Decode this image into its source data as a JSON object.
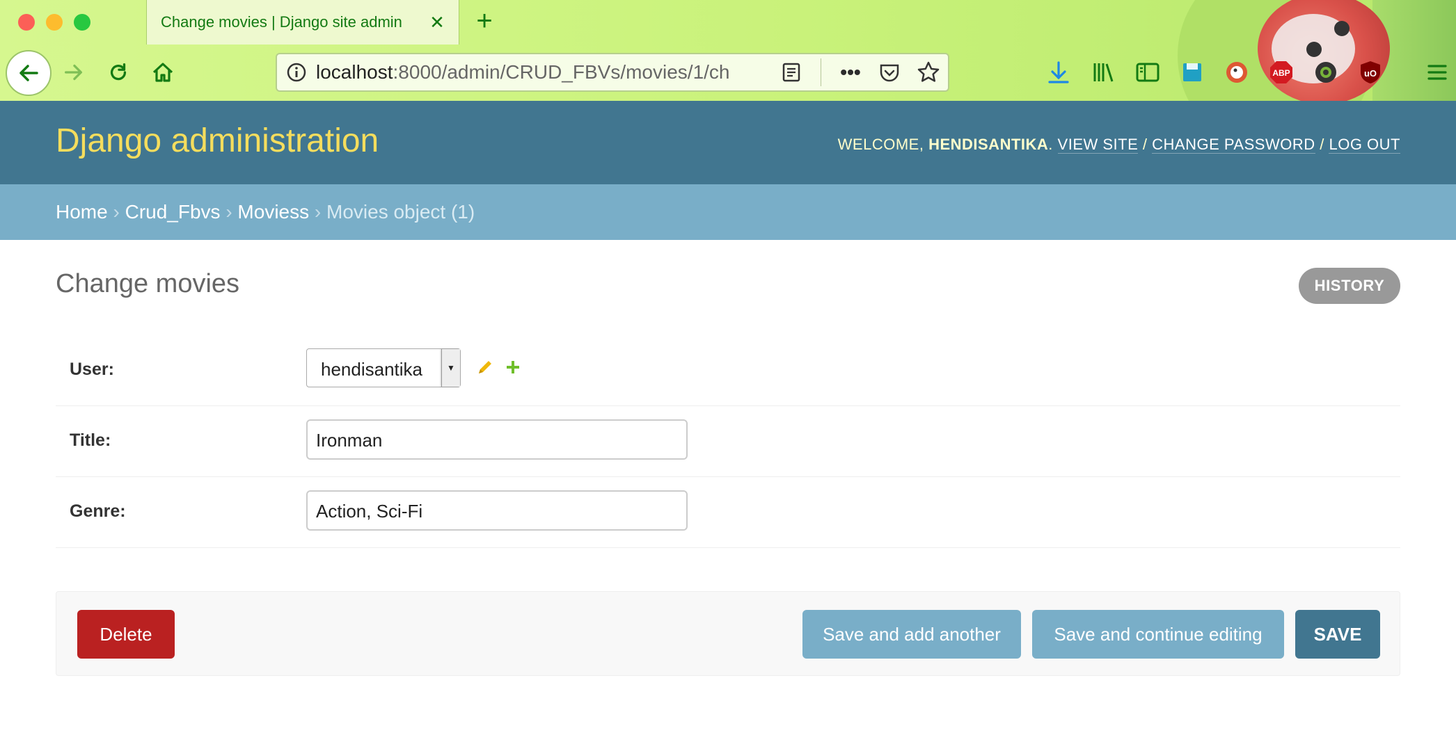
{
  "browser": {
    "tab_title": "Change movies | Django site admin",
    "url_host": "localhost",
    "url_rest": ":8000/admin/CRUD_FBVs/movies/1/ch",
    "colors": {
      "chrome": "#c9f27a",
      "icon": "#137a13"
    }
  },
  "header": {
    "branding": "Django administration",
    "welcome": "WELCOME,",
    "username": "HENDISANTIKA",
    "view_site": "VIEW SITE",
    "change_password": "CHANGE PASSWORD",
    "log_out": "LOG OUT",
    "separator": "/"
  },
  "breadcrumbs": {
    "items": [
      "Home",
      "Crud_Fbvs",
      "Moviess"
    ],
    "current": "Movies object (1)",
    "separator": "›"
  },
  "page": {
    "title": "Change movies",
    "history": "HISTORY"
  },
  "form": {
    "user": {
      "label": "User:",
      "value": "hendisantika"
    },
    "title": {
      "label": "Title:",
      "value": "Ironman"
    },
    "genre": {
      "label": "Genre:",
      "value": "Action, Sci-Fi"
    }
  },
  "actions": {
    "delete": "Delete",
    "save_add": "Save and add another",
    "save_continue": "Save and continue editing",
    "save": "SAVE"
  },
  "colors": {
    "header_bg": "#417690",
    "branding": "#f5dd5d",
    "breadcrumbs_bg": "#79aec8",
    "delete_bg": "#ba2121",
    "secondary_btn": "#79aec8",
    "primary_btn": "#417690"
  }
}
